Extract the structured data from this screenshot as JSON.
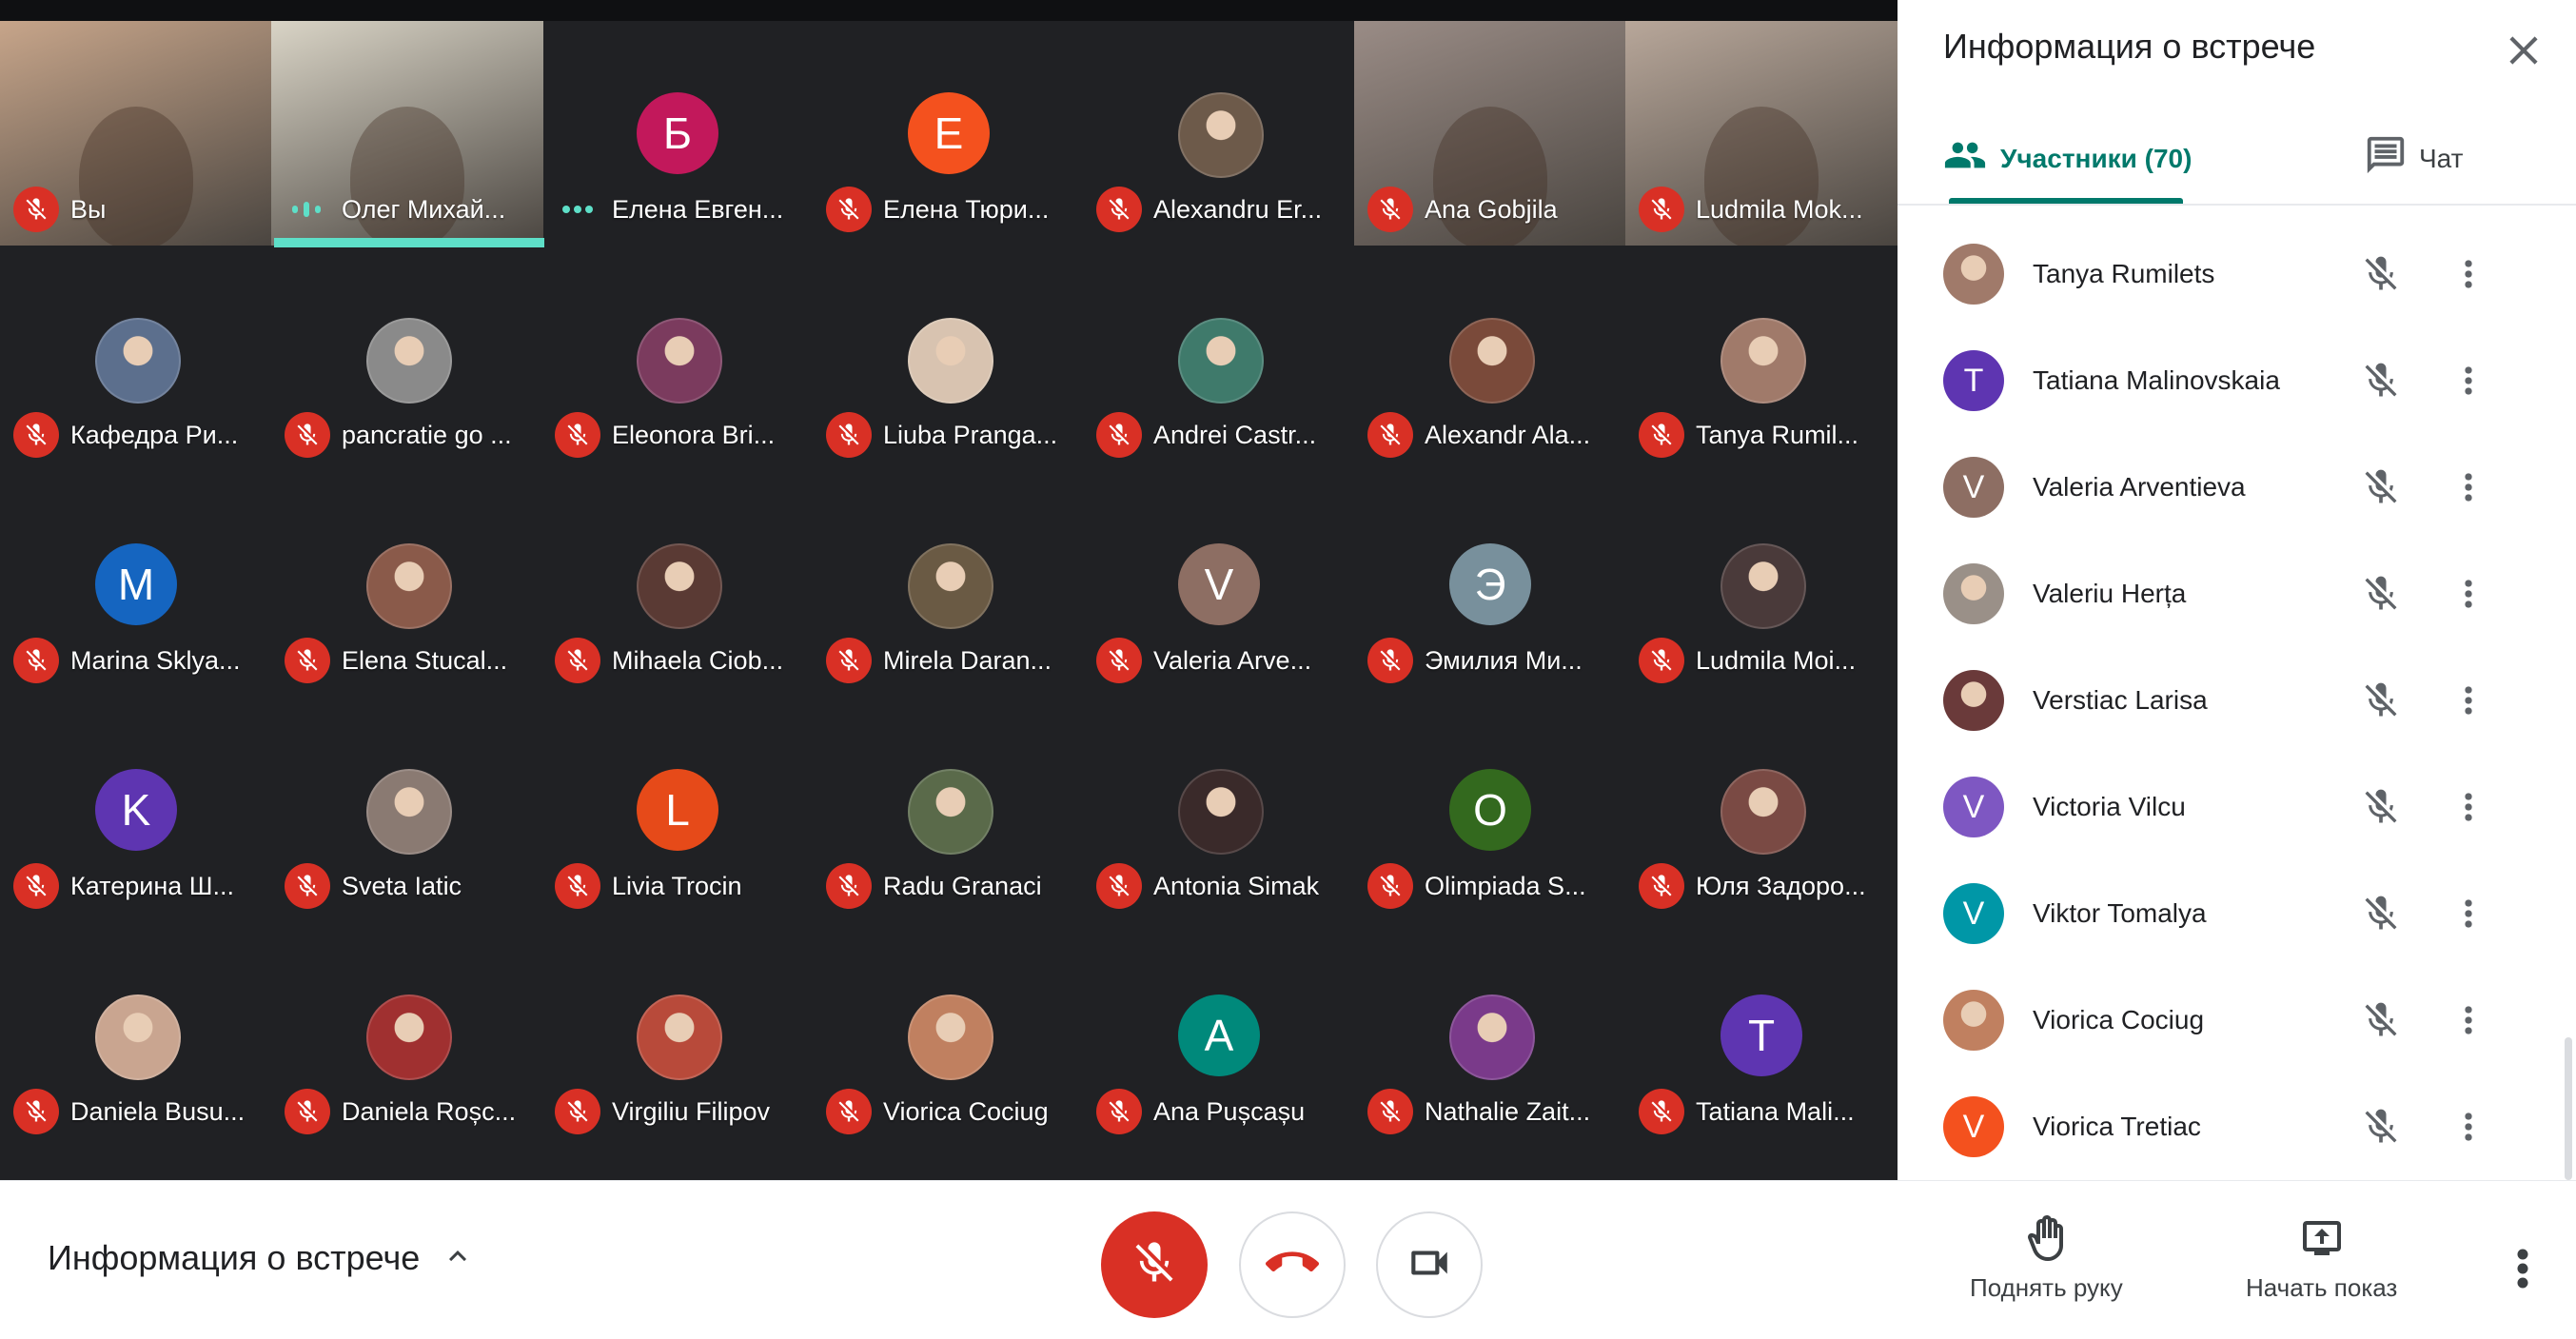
{
  "stage": {
    "tiles": [
      {
        "name": "Вы",
        "kind": "video",
        "bg": "#c7a58a",
        "mic": "muted"
      },
      {
        "name": "Олег Михай...",
        "kind": "video",
        "bg": "#d9d4c6",
        "mic": "speaking"
      },
      {
        "name": "Елена Евген...",
        "kind": "avatar",
        "letter": "Б",
        "color": "#c2185b",
        "mic": "dots"
      },
      {
        "name": "Елена Тюри...",
        "kind": "avatar",
        "letter": "Е",
        "color": "#f4511e",
        "mic": "muted"
      },
      {
        "name": "Alexandru Er...",
        "kind": "photo",
        "color": "#6d5a4a",
        "mic": "muted"
      },
      {
        "name": "Ana Gobjila",
        "kind": "video",
        "bg": "#9a8c86",
        "mic": "muted"
      },
      {
        "name": "Ludmila Mok...",
        "kind": "video",
        "bg": "#b8a79a",
        "mic": "muted"
      },
      {
        "name": "Кафедра Ри...",
        "kind": "photo",
        "color": "#5c6f8d",
        "mic": "muted"
      },
      {
        "name": "pancratie go ...",
        "kind": "photo",
        "color": "#8a8a8a",
        "mic": "muted"
      },
      {
        "name": "Eleonora Bri...",
        "kind": "photo",
        "color": "#7b3b5e",
        "mic": "muted"
      },
      {
        "name": "Liuba Pranga...",
        "kind": "photo",
        "color": "#d8c3b0",
        "mic": "muted"
      },
      {
        "name": "Andrei Castr...",
        "kind": "photo",
        "color": "#3f7a6b",
        "mic": "muted"
      },
      {
        "name": "Alexandr Ala...",
        "kind": "photo",
        "color": "#7a4a3a",
        "mic": "muted"
      },
      {
        "name": "Tanya Rumil...",
        "kind": "photo",
        "color": "#a07a6a",
        "mic": "muted"
      },
      {
        "name": "Marina Sklya...",
        "kind": "avatar",
        "letter": "M",
        "color": "#1565c0",
        "mic": "muted"
      },
      {
        "name": "Elena Stucal...",
        "kind": "photo",
        "color": "#8a5a4a",
        "mic": "muted"
      },
      {
        "name": "Mihaela Ciob...",
        "kind": "photo",
        "color": "#5a3a34",
        "mic": "muted"
      },
      {
        "name": "Mirela Daran...",
        "kind": "photo",
        "color": "#6a5a44",
        "mic": "muted"
      },
      {
        "name": "Valeria Arve...",
        "kind": "avatar",
        "letter": "V",
        "color": "#8d6e63",
        "mic": "muted"
      },
      {
        "name": "Эмилия Ми...",
        "kind": "avatar",
        "letter": "Э",
        "color": "#78909c",
        "mic": "muted"
      },
      {
        "name": "Ludmila Moi...",
        "kind": "photo",
        "color": "#4a3a3a",
        "mic": "muted"
      },
      {
        "name": "Катерина Ш...",
        "kind": "avatar",
        "letter": "K",
        "color": "#5e35b1",
        "mic": "muted"
      },
      {
        "name": "Sveta Iatic",
        "kind": "photo",
        "color": "#8a7a72",
        "mic": "muted"
      },
      {
        "name": "Livia Trocin",
        "kind": "avatar",
        "letter": "L",
        "color": "#e64a19",
        "mic": "muted"
      },
      {
        "name": "Radu Granaci",
        "kind": "photo",
        "color": "#5a6a4a",
        "mic": "muted"
      },
      {
        "name": "Antonia Simak",
        "kind": "photo",
        "color": "#3a2a2a",
        "mic": "muted"
      },
      {
        "name": "Olimpiada S...",
        "kind": "avatar",
        "letter": "O",
        "color": "#33691e",
        "mic": "muted"
      },
      {
        "name": "Юля Задоро...",
        "kind": "photo",
        "color": "#7a4a44",
        "mic": "muted"
      },
      {
        "name": "Daniela Busu...",
        "kind": "photo",
        "color": "#c9a590",
        "mic": "muted"
      },
      {
        "name": "Daniela Roșc...",
        "kind": "photo",
        "color": "#a03030",
        "mic": "muted"
      },
      {
        "name": "Virgiliu Filipov",
        "kind": "photo",
        "color": "#b84a3a",
        "mic": "muted"
      },
      {
        "name": "Viorica Cociug",
        "kind": "photo",
        "color": "#c08060",
        "mic": "muted"
      },
      {
        "name": "Ana Pușcașu",
        "kind": "avatar",
        "letter": "A",
        "color": "#00897b",
        "mic": "muted"
      },
      {
        "name": "Nathalie Zait...",
        "kind": "photo",
        "color": "#7a3a8a",
        "mic": "muted"
      },
      {
        "name": "Tatiana Mali...",
        "kind": "avatar",
        "letter": "T",
        "color": "#5e35b1",
        "mic": "muted"
      }
    ]
  },
  "panel": {
    "title": "Информация о встрече",
    "tabs": [
      {
        "label": "Участники (70)",
        "icon": "people-icon",
        "active": true
      },
      {
        "label": "Чат",
        "icon": "chat-icon",
        "active": false
      }
    ],
    "participants": [
      {
        "name": "Tanya Rumilets",
        "kind": "photo",
        "color": "#a07a6a"
      },
      {
        "name": "Tatiana Malinovskaia",
        "kind": "avatar",
        "letter": "T",
        "color": "#5e35b1"
      },
      {
        "name": "Valeria Arventieva",
        "kind": "avatar",
        "letter": "V",
        "color": "#8d6e63"
      },
      {
        "name": "Valeriu Herța",
        "kind": "photo",
        "color": "#9a9088"
      },
      {
        "name": "Verstiac Larisa",
        "kind": "photo",
        "color": "#6a3a3a"
      },
      {
        "name": "Victoria Vilcu",
        "kind": "avatar",
        "letter": "V",
        "color": "#7e57c2"
      },
      {
        "name": "Viktor Tomalya",
        "kind": "avatar",
        "letter": "V",
        "color": "#0097a7"
      },
      {
        "name": "Viorica Cociug",
        "kind": "photo",
        "color": "#c08060"
      },
      {
        "name": "Viorica Tretiac",
        "kind": "avatar",
        "letter": "V",
        "color": "#f4511e"
      }
    ]
  },
  "bottombar": {
    "meeting_details_label": "Информация о встрече",
    "raise_hand_label": "Поднять руку",
    "present_label": "Начать показ"
  },
  "colors": {
    "stage_bg": "#202124",
    "muted_red": "#d93025",
    "accent_teal": "#00796b",
    "speaking_bar": "#5edfc8"
  }
}
